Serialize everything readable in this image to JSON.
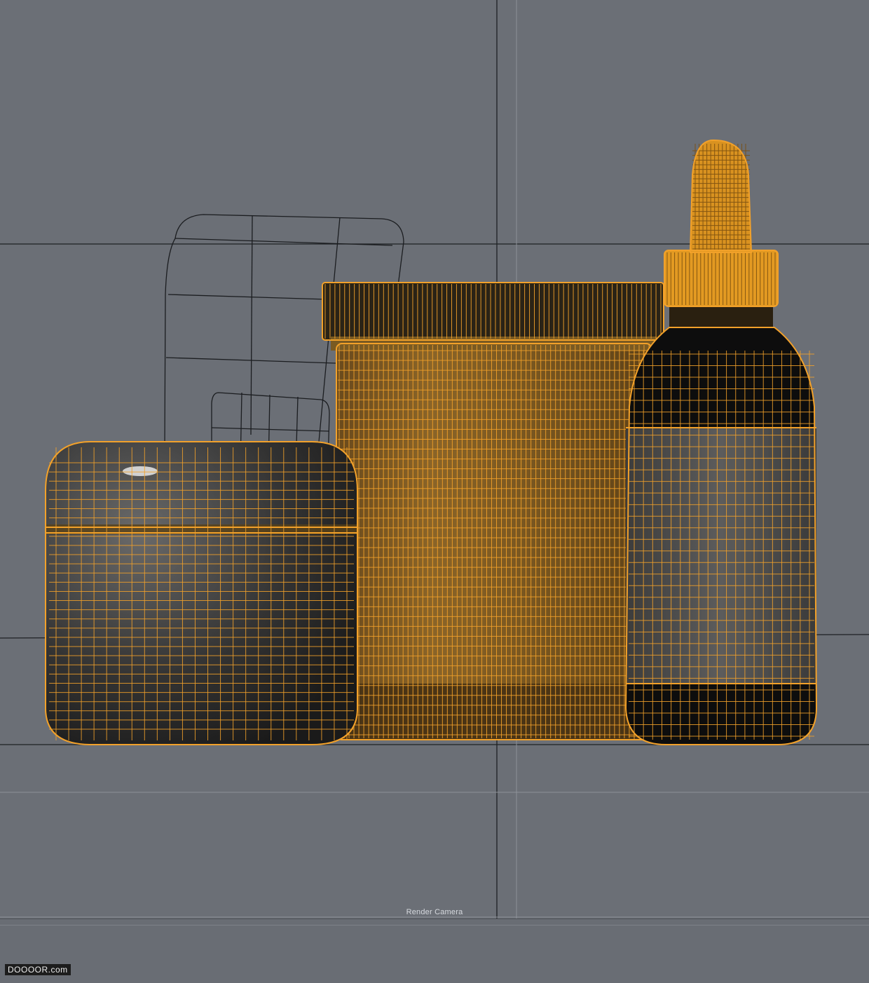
{
  "viewport": {
    "label": "Render Camera",
    "background": "#6b6f76",
    "wire_color": "#f2a12a",
    "selected_objects": [
      "cream-jar",
      "supplement-jar",
      "dropper-bottle"
    ],
    "unselected_objects": [
      "background-cage-large",
      "background-cage-small"
    ]
  },
  "watermark": {
    "text": "DOOOOR.com"
  }
}
